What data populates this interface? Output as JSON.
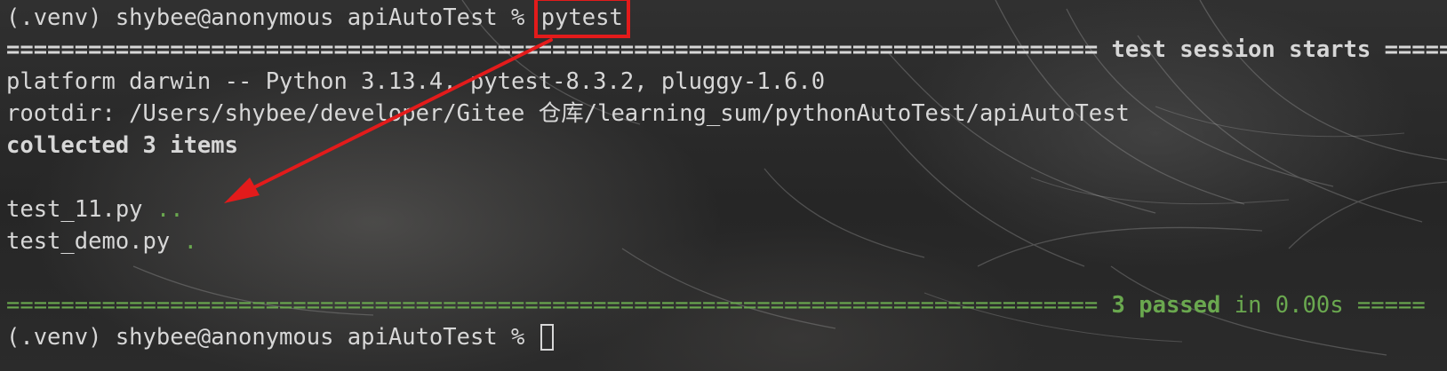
{
  "terminal": {
    "prompt": "(.venv) shybee@anonymous apiAutoTest % ",
    "command": "pytest",
    "session_header": "================================================================================ test session starts =====",
    "platform_line": "platform darwin -- Python 3.13.4, pytest-8.3.2, pluggy-1.6.0",
    "rootdir_line": "rootdir: /Users/shybee/developer/Gitee 仓库/learning_sum/pythonAutoTest/apiAutoTest",
    "collected_line": "collected 3 items",
    "results": [
      {
        "file": "test_11.py ",
        "dots": ".."
      },
      {
        "file": "test_demo.py ",
        "dots": "."
      }
    ],
    "summary_left_sep": "================================================================================ ",
    "summary_passed": "3 passed",
    "summary_time": " in 0.00s ",
    "summary_right_sep": "=====",
    "final_prompt": "(.venv) shybee@anonymous apiAutoTest % "
  },
  "annotation": {
    "color": "#e31b1b"
  }
}
